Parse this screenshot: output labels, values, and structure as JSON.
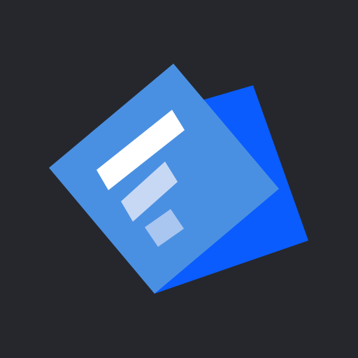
{
  "icon": {
    "name": "document-stack-icon",
    "colors": {
      "background": "#25272d",
      "back_sheet": "#0a5cff",
      "front_sheet": "#4a90e2",
      "line_primary": "#ffffff",
      "line_secondary": "#c7d8f5",
      "line_tertiary": "#a9c6f0"
    }
  }
}
